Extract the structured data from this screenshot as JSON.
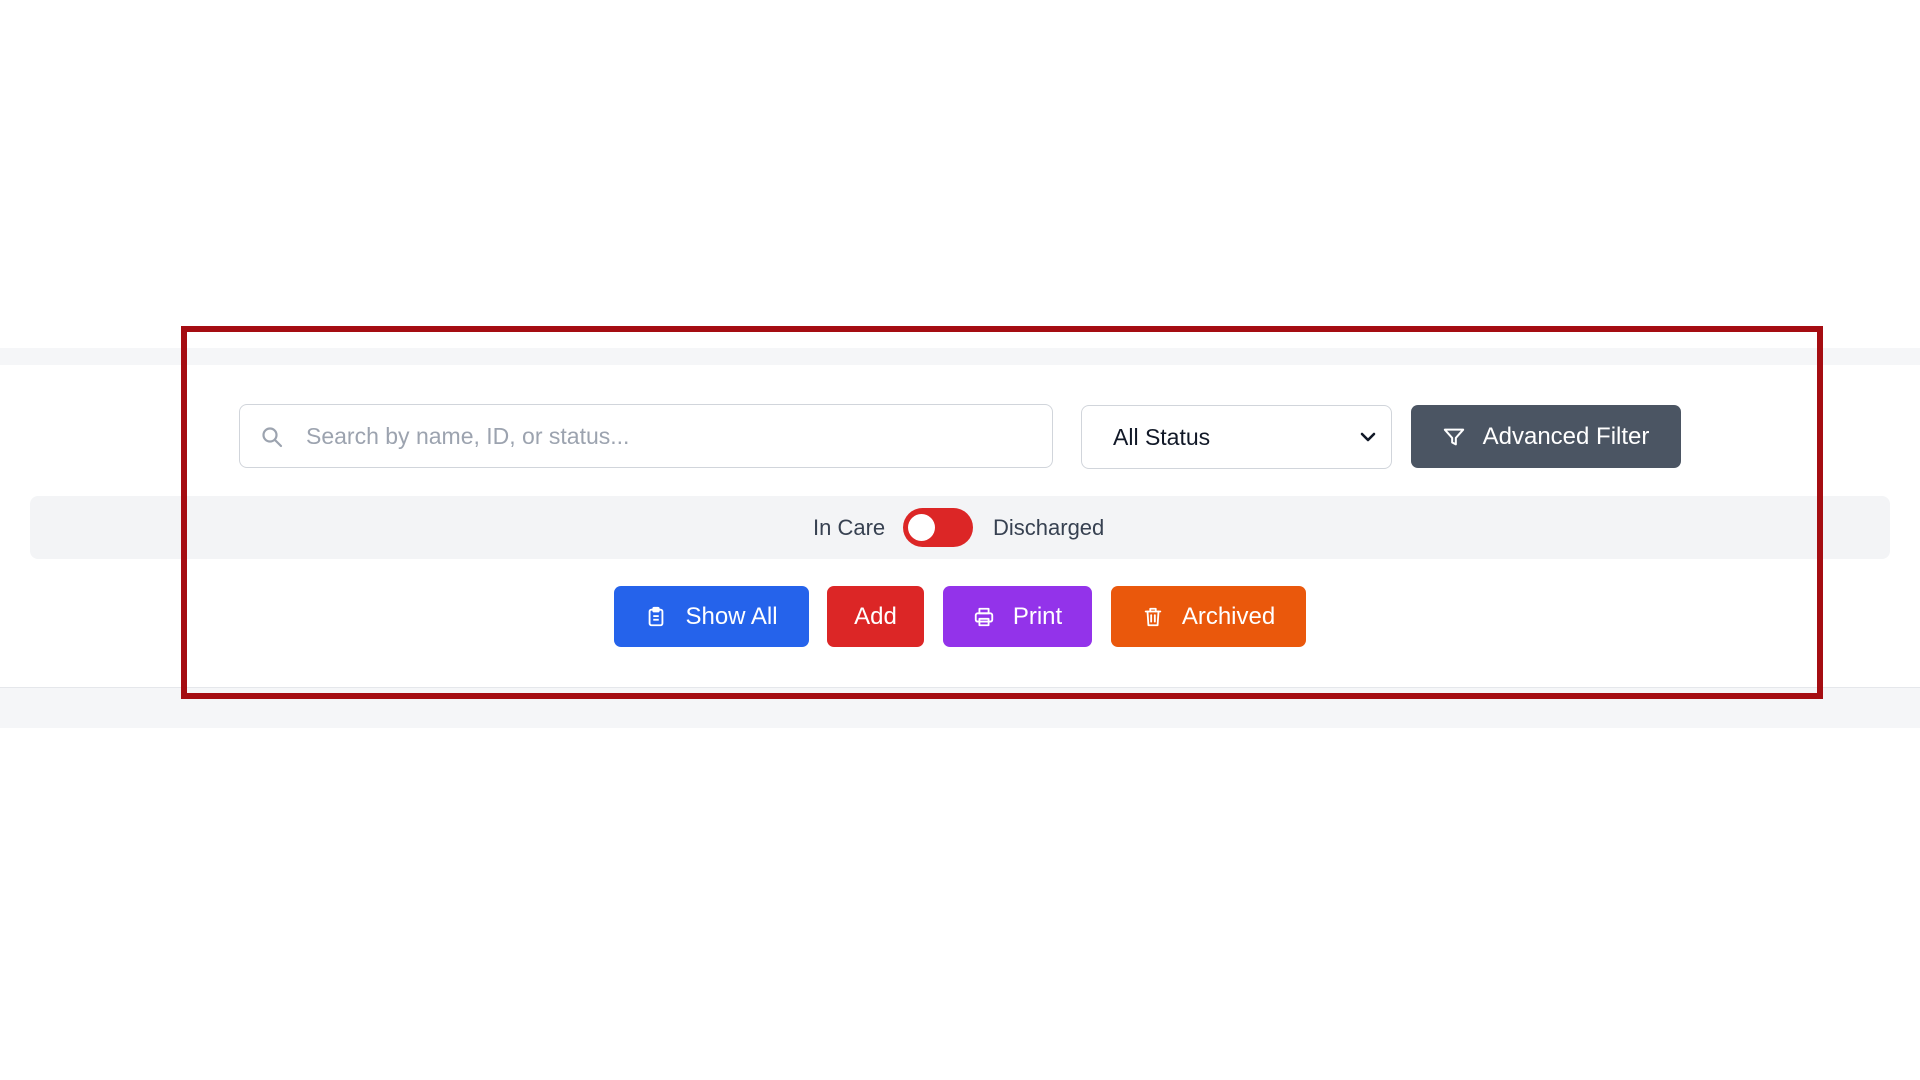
{
  "search": {
    "placeholder": "Search by name, ID, or status...",
    "icon": "search-icon"
  },
  "status_filter": {
    "selected": "All Status",
    "icon": "chevron-down-icon"
  },
  "advanced_filter": {
    "label": "Advanced Filter",
    "icon": "filter-icon"
  },
  "care_toggle": {
    "left_label": "In Care",
    "right_label": "Discharged",
    "on_color": "#dc2626"
  },
  "actions": {
    "show_all": {
      "label": "Show All",
      "icon": "clipboard-icon",
      "color": "#2563eb"
    },
    "add": {
      "label": "Add",
      "color": "#dc2626"
    },
    "print": {
      "label": "Print",
      "icon": "printer-icon",
      "color": "#9333ea"
    },
    "archived": {
      "label": "Archived",
      "icon": "trash-icon",
      "color": "#ea580c"
    }
  },
  "highlight_color": "#a50d12"
}
